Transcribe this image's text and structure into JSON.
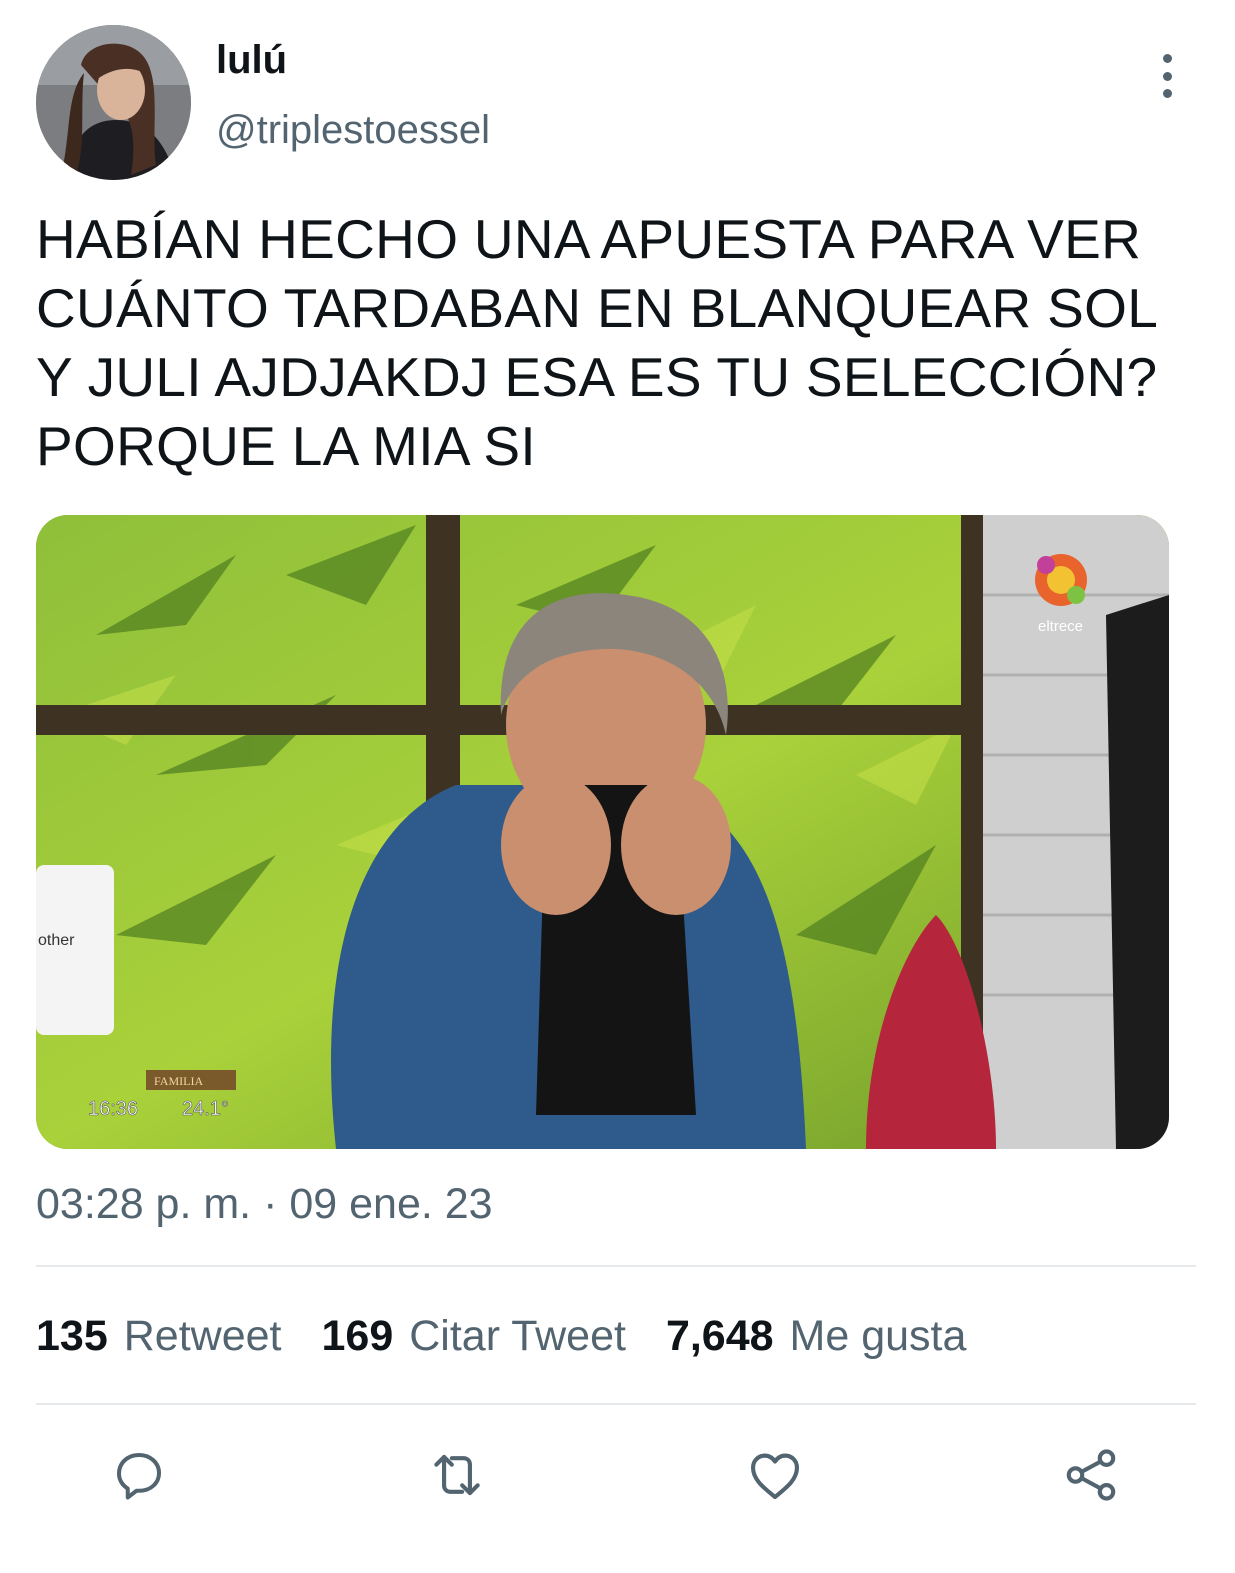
{
  "tweet": {
    "display_name": "lulú",
    "handle": "@triplestoessel",
    "text_lines": [
      "HABÍAN HECHO UNA APUESTA PARA VER",
      "CUÁNTO TARDABAN EN BLANQUEAR SOL",
      "Y JULI AJDJAKDJ ESA ES TU SELECCIÓN?",
      "PORQUE LA MIA SI"
    ],
    "timestamp": "03:28 p. m. · 09 ene. 23",
    "media": {
      "channel_logo_text": "eltrece",
      "machine_brand": "other",
      "sign_text": "FAMILIA",
      "clock": "16:36",
      "temperature": "24.1°"
    }
  },
  "stats": {
    "retweets": {
      "count": "135",
      "label": "Retweet"
    },
    "quotes": {
      "count": "169",
      "label": "Citar Tweet"
    },
    "likes": {
      "count": "7,648",
      "label": "Me gusta"
    }
  },
  "icons": {
    "more": "more-vertical-icon",
    "reply": "reply-icon",
    "retweet": "retweet-icon",
    "like": "heart-icon",
    "share": "share-icon"
  },
  "colors": {
    "primary_text": "#0f1419",
    "secondary_text": "#536471",
    "divider": "#e6e9ec"
  }
}
